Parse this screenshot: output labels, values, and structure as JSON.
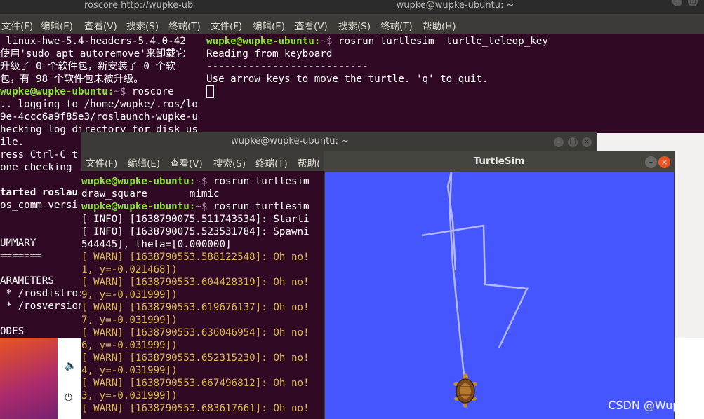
{
  "terminal1": {
    "title": "roscore http://wupke-ub",
    "menu": [
      "文件(F)",
      "编辑(E)",
      "查看(V)",
      "搜索(S)",
      "终端(T)"
    ],
    "prompt": "wupke@wupke-ubuntu:",
    "prompt_path": "~$",
    "lines": [
      " linux-hwe-5.4-headers-5.4.0-42",
      "使用'sudo apt autoremove'来卸载它",
      "升级了 0 个软件包，新安装了 0 个软",
      "包，有 98 个软件包未被升级。",
      " roscore",
      ".. logging to /home/wupke/.ros/lo",
      "9e-4ccc6a9f85e3/roslaunch-wupke-u",
      "hecking log directory for disk us",
      "ile.",
      "ress Ctrl-C t",
      "one checking",
      "",
      "tarted roslau",
      "os_comm versi",
      "",
      "",
      "UMMARY",
      "=======",
      "",
      "ARAMETERS",
      " * /rosdistro:",
      " * /rosversion",
      "",
      "ODES"
    ]
  },
  "terminal2": {
    "title": "wupke@wupke-ubuntu: ~",
    "menu": [
      "文件(F)",
      "编辑(E)",
      "查看(V)",
      "搜索(S)",
      "终端(T)",
      "帮助(H)"
    ],
    "prompt": "wupke@wupke-ubuntu:",
    "prompt_path": "~$",
    "command": " rosrun turtlesim  turtle_teleop_key",
    "lines": [
      "Reading from keyboard",
      "---------------------------",
      "Use arrow keys to move the turtle. 'q' to quit."
    ]
  },
  "terminal3": {
    "title": "wupke@wupke-ubuntu: ~",
    "menu": [
      "文件(F)",
      "编辑(E)",
      "查看(V)",
      "搜索(S)",
      "终端(T)",
      "帮助("
    ],
    "prompt": "wupke@wupke-ubuntu:",
    "prompt_path": "~$",
    "cmd1": " rosrun turtlesim",
    "completions": "draw_square       mimic",
    "cmd2": " rosrun turtlesim",
    "info_lines": [
      "[ INFO] [1638790075.511743534]: Starti",
      "[ INFO] [1638790075.523531784]: Spawni",
      "544445], theta=[0.000000]"
    ],
    "warn_lines": [
      "[ WARN] [1638790553.588122548]: Oh no!",
      "1, y=-0.021468])",
      "[ WARN] [1638790553.604428319]: Oh no!",
      "9, y=-0.031999])",
      "[ WARN] [1638790553.619676137]: Oh no!",
      "7, y=-0.031999])",
      "[ WARN] [1638790553.636046954]: Oh no!",
      "6, y=-0.031999])",
      "[ WARN] [1638790553.652315230]: Oh no!",
      "4, y=-0.031999])",
      "[ WARN] [1638790553.667496812]: Oh no!",
      "3, y=-0.031999])",
      "[ WARN] [1638790553.683617661]: Oh no!"
    ]
  },
  "turtlesim": {
    "title": "TurtleSim",
    "background_color": "#4556ff",
    "pen_color": "#b3b8ff"
  },
  "settings_icons": [
    "volume-icon",
    "power-plug-icon"
  ],
  "watermark": "CSDN @Wupke"
}
